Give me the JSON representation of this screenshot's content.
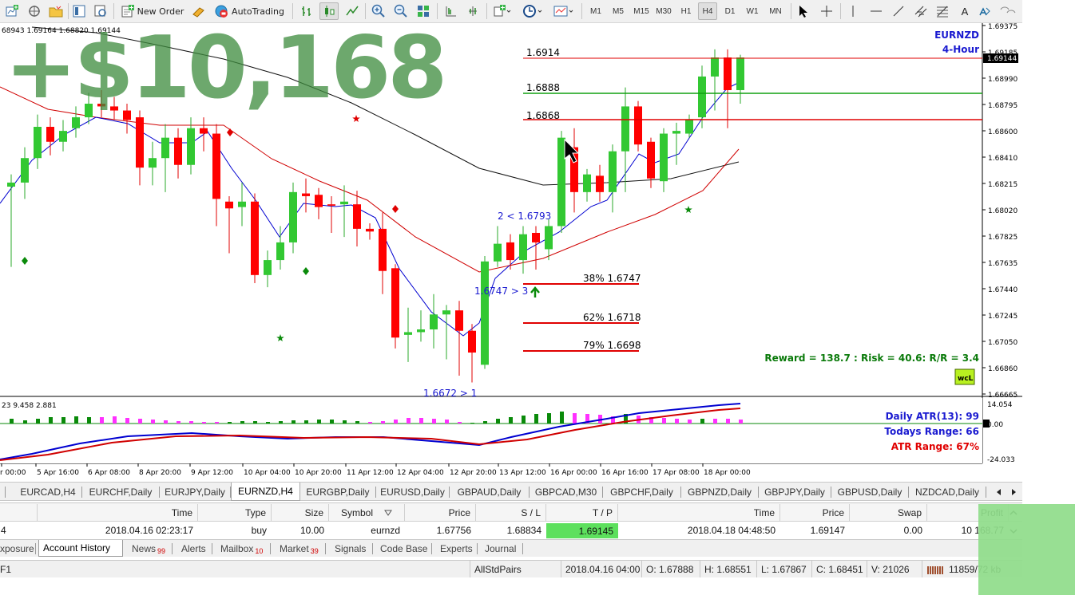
{
  "toolbar": {
    "new_order": "New Order",
    "autotrading": "AutoTrading",
    "timeframes": [
      "M1",
      "M5",
      "M15",
      "M30",
      "H1",
      "H4",
      "D1",
      "W1",
      "MN"
    ],
    "active_timeframe": "H4",
    "text_tool": "A"
  },
  "chart": {
    "ohlc_readout": "68943 1.69164 1.68820 1.69144",
    "symbol": "EURNZD",
    "timeframe": "4-Hour",
    "current_price": "1.69144",
    "price_ticks": [
      "1.69375",
      "1.69185",
      "1.68990",
      "1.68795",
      "1.68600",
      "1.68410",
      "1.68215",
      "1.68020",
      "1.67825",
      "1.67635",
      "1.67440",
      "1.67245",
      "1.67050",
      "1.66860",
      "1.66665"
    ],
    "time_ticks": [
      "r 00:00",
      "5 Apr 16:00",
      "6 Apr 08:00",
      "8 Apr 20:00",
      "9 Apr 12:00",
      "10 Apr 04:00",
      "10 Apr 20:00",
      "11 Apr 12:00",
      "12 Apr 04:00",
      "12 Apr 20:00",
      "13 Apr 12:00",
      "16 Apr 00:00",
      "16 Apr 16:00",
      "17 Apr 08:00",
      "18 Apr 00:00"
    ],
    "levels": {
      "l1": "1.6914",
      "l2": "1.6888",
      "l3": "1.6868",
      "fib38": "38% 1.6747",
      "fib62": "62% 1.6718",
      "fib79": "79% 1.6698"
    },
    "annotations": {
      "a1": "2 < 1.6793",
      "a2": "1.6747 > 3",
      "a3": "1.6672 > 1"
    },
    "reward_risk": "Reward = 138.7 : Risk = 40.6: R/R = 3.4",
    "logo": "wcL",
    "profit_overlay": "+$10,168"
  },
  "indicator": {
    "readout": "23 9.458 2.881",
    "ticks": [
      "14.054",
      "0.00",
      "-24.033"
    ],
    "daily_atr": "Daily ATR(13): 99",
    "todays_range": "Todays Range: 66",
    "atr_range": "ATR Range: 67%"
  },
  "chart_tabs": [
    "EURCAD,H4",
    "EURCHF,Daily",
    "EURJPY,Daily",
    "EURNZD,H4",
    "EURGBP,Daily",
    "EURUSD,Daily",
    "GBPAUD,Daily",
    "GBPCAD,M30",
    "GBPCHF,Daily",
    "GBPNZD,Daily",
    "GBPJPY,Daily",
    "GBPUSD,Daily",
    "NZDCAD,Daily"
  ],
  "active_chart_tab": "EURNZD,H4",
  "terminal": {
    "headers": {
      "time": "Time",
      "type": "Type",
      "size": "Size",
      "symbol": "Symbol",
      "price": "Price",
      "sl": "S / L",
      "tp": "T / P",
      "time2": "Time",
      "price2": "Price",
      "swap": "Swap",
      "profit": "Profit"
    },
    "row": {
      "ticket": "4",
      "time": "2018.04.16 02:23:17",
      "type": "buy",
      "size": "10.00",
      "symbol": "eurnzd",
      "price": "1.67756",
      "sl": "1.68834",
      "tp": "1.69145",
      "time2": "2018.04.18 04:48:50",
      "price2": "1.69147",
      "swap": "0.00",
      "profit": "10 168.77"
    }
  },
  "bottom_tabs": {
    "exposure": "xposure",
    "account_history": "Account History",
    "news": "News",
    "news_count": "99",
    "alerts": "Alerts",
    "mailbox": "Mailbox",
    "mailbox_count": "10",
    "market": "Market",
    "market_count": "39",
    "signals": "Signals",
    "code_base": "Code Base",
    "experts": "Experts",
    "journal": "Journal"
  },
  "status": {
    "help": "F1",
    "profile": "AllStdPairs",
    "datetime": "2018.04.16 04:00",
    "open": "O: 1.67888",
    "high": "H: 1.68551",
    "low": "L: 1.67867",
    "close": "C: 1.68451",
    "volume": "V: 21026",
    "traffic": "11859/72 kb"
  },
  "colors": {
    "bull": "#32c832",
    "bear": "#ff0000",
    "blue_line": "#0000d0",
    "red_line": "#d00000",
    "green_line": "#0a8a0a",
    "overlay": "#3d8b3d"
  }
}
